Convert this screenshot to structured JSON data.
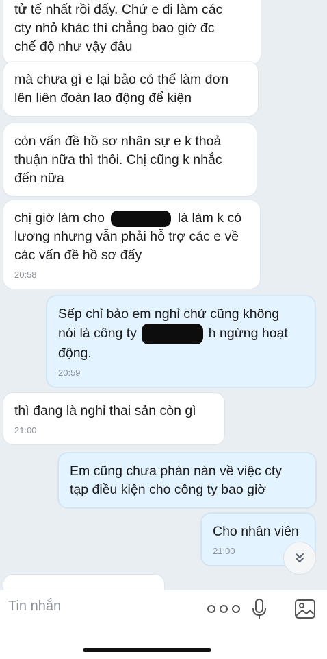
{
  "messages": [
    {
      "lines": [
        "tử tế nhất rồi đấy. Chứ e đi làm các",
        "cty nhỏ khác thì chẳng bao giờ đc",
        "chế độ như vậy đâu"
      ]
    },
    {
      "lines": [
        "mà chưa gì e lại bảo có thể làm đơn",
        "lên liên đoàn lao động để kiện"
      ]
    },
    {
      "lines": [
        "còn vấn đề hồ sơ nhân sự e k thoả",
        "thuận nữa thì thôi. Chị cũng k nhắc",
        "đến nữa"
      ]
    },
    {
      "line1_start": "chị giờ làm cho",
      "line1_end": "là làm k có",
      "lines": [
        "lương nhưng vẫn phải hỗ trợ các e về",
        "các vấn đề hồ sơ đấy"
      ],
      "time": "20:58"
    },
    {
      "line1": "Sếp chỉ bảo em nghỉ chứ cũng không",
      "line2_start": "nói là công ty",
      "line2_end": "h ngừng hoạt",
      "line3": "động.",
      "time": "20:59"
    },
    {
      "lines": [
        "thì đang là nghỉ thai sản còn gì"
      ],
      "time": "21:00"
    },
    {
      "lines": [
        "Em cũng chưa phàn nàn về việc cty",
        "tạp điều kiện cho công ty bao giờ"
      ]
    },
    {
      "lines": [
        "Cho nhân viên"
      ],
      "time": "21:00"
    }
  ],
  "composer": {
    "placeholder": "Tin nhắn"
  },
  "icons": {
    "scroll": "chevron-double-down-icon",
    "more": "more-dots-icon",
    "mic": "microphone-icon",
    "image": "image-icon"
  }
}
